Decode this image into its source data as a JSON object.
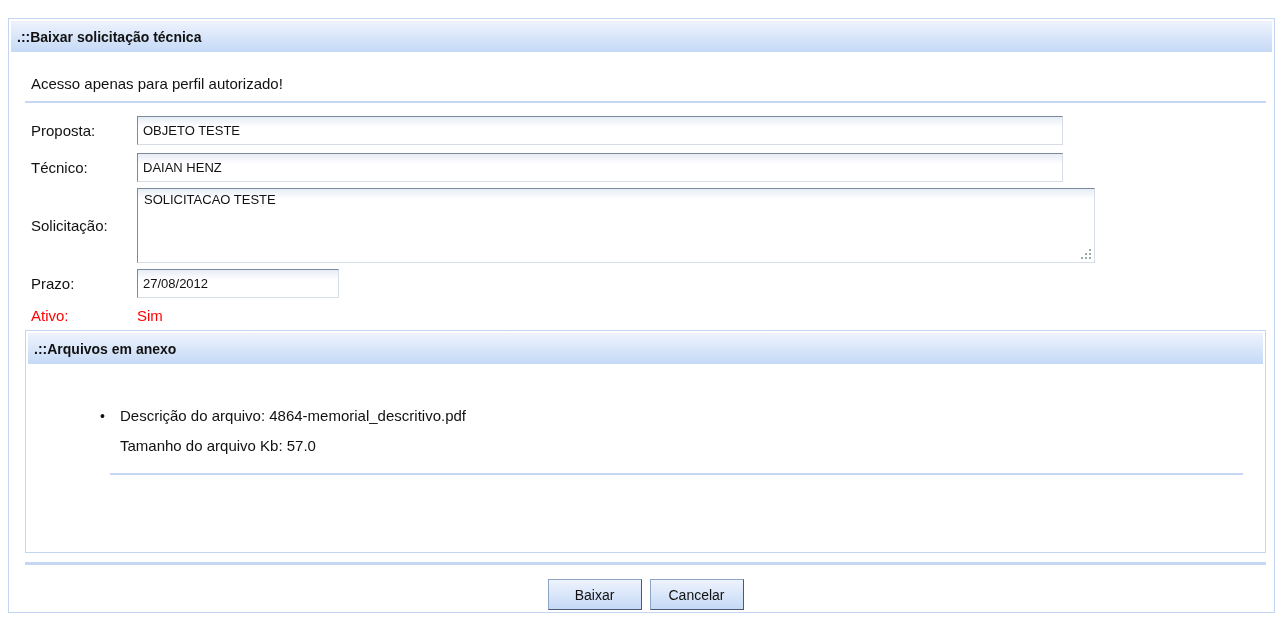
{
  "panel": {
    "title": ".::Baixar solicitação técnica"
  },
  "message": "Acesso apenas para perfil autorizado!",
  "fields": [
    {
      "label": "Proposta:",
      "kind": "text",
      "value": "OBJETO TESTE"
    },
    {
      "label": "Técnico:",
      "kind": "text",
      "value": "DAIAN HENZ"
    },
    {
      "label": "Solicitação:",
      "kind": "textarea",
      "value": "SOLICITACAO TESTE"
    },
    {
      "label": "Prazo:",
      "kind": "date",
      "value": "27/08/2012"
    }
  ],
  "status": {
    "label": "Ativo:",
    "value": "Sim"
  },
  "attachments": {
    "title": ".::Arquivos em anexo",
    "items": [
      {
        "marker": "•",
        "description": "Descrição do arquivo: 4864-memorial_descritivo.pdf",
        "size": "Tamanho do arquivo Kb: 57.0"
      }
    ]
  },
  "buttons": [
    "Baixar",
    "Cancelar"
  ]
}
